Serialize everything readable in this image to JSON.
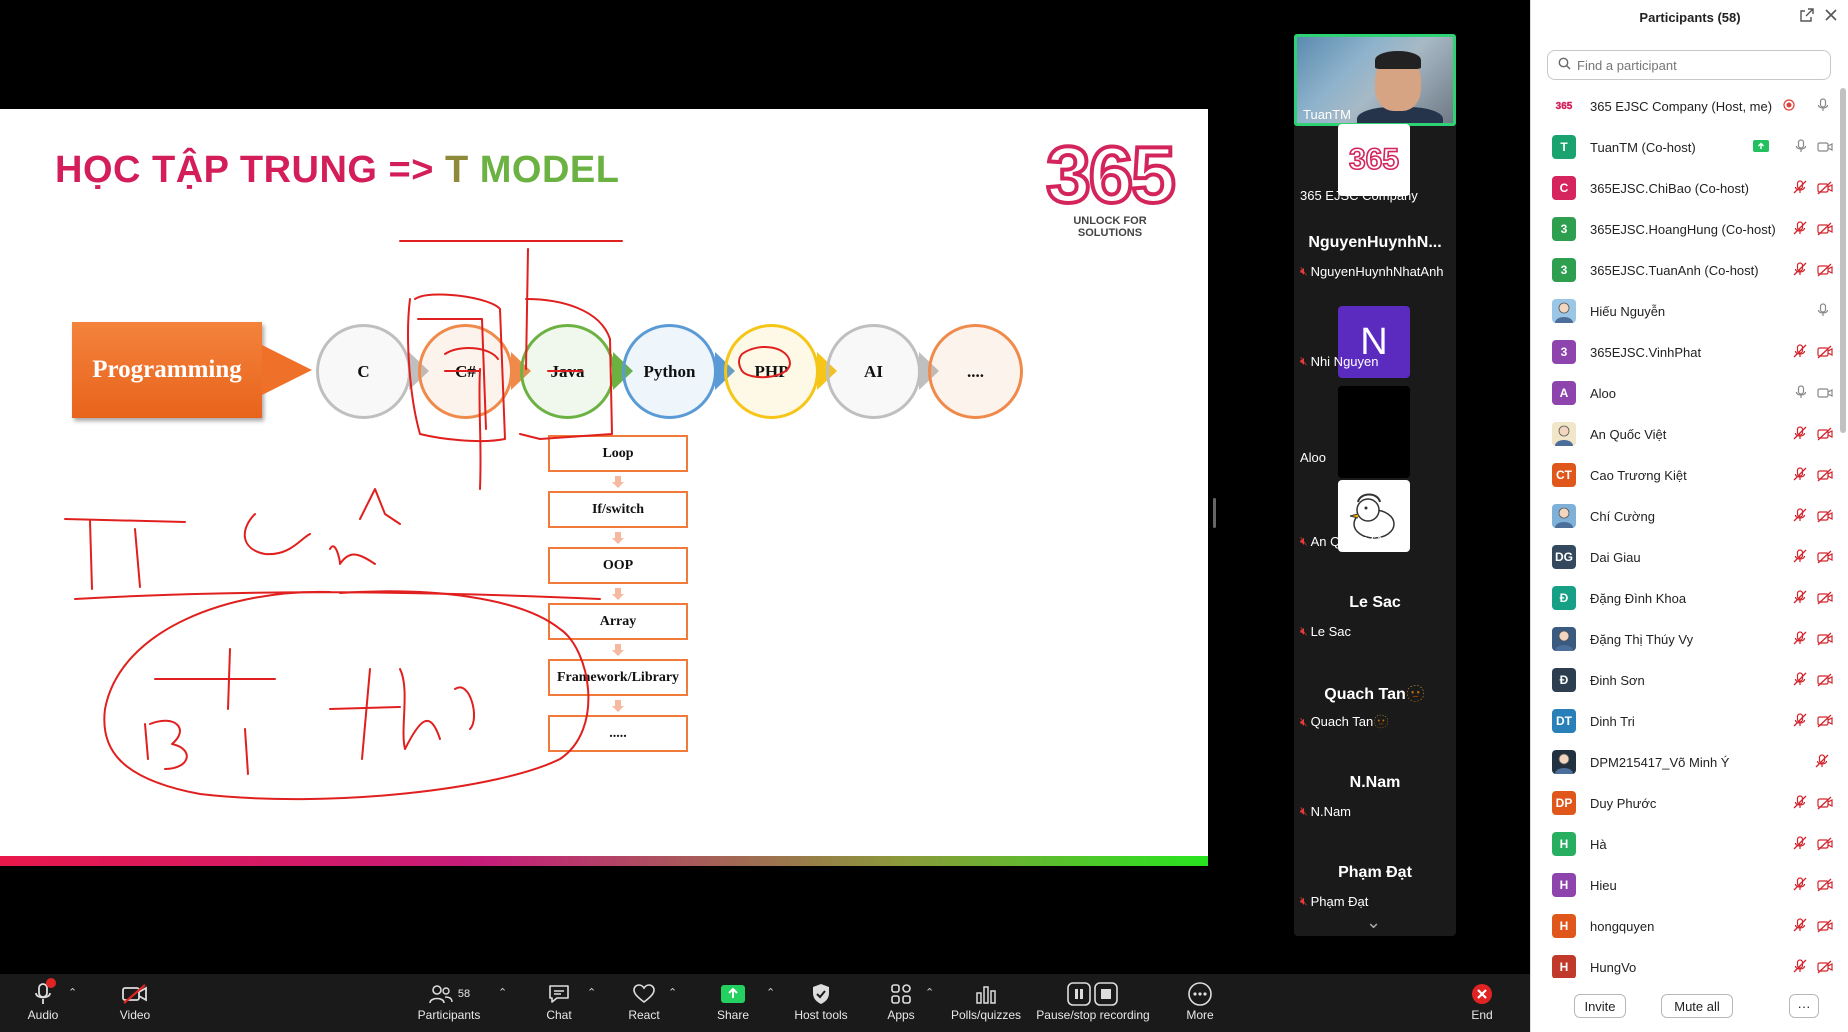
{
  "slide": {
    "title_part1": "HỌC TẬP TRUNG => ",
    "title_part2": "T ",
    "title_part3": "MODEL",
    "logo_number": "365",
    "logo_tagline": "UNLOCK FOR SOLUTIONS",
    "root_box": "Programming",
    "languages": [
      {
        "label": "C",
        "color": "#bfbfbf"
      },
      {
        "label": "C#",
        "color": "#f08a4b"
      },
      {
        "label": "Java",
        "color": "#6bb243"
      },
      {
        "label": "Python",
        "color": "#5b9bd5"
      },
      {
        "label": "PHP",
        "color": "#f5c518"
      },
      {
        "label": "AI",
        "color": "#bfbfbf"
      },
      {
        "label": "....",
        "color": "#f08a4b"
      }
    ],
    "steps": [
      "Loop",
      "If/switch",
      "OOP",
      "Array",
      "Framework/Library",
      "....."
    ]
  },
  "video_strip": {
    "active_speaker": "TuanTM",
    "company_tile": "365 EJSC Company",
    "company_logo": "365",
    "tiles": [
      {
        "big": "NguyenHuynhN...",
        "name": "NguyenHuynhNhatAnh",
        "muted": true
      },
      {
        "avatar": "N",
        "name": "Nhi Nguyen",
        "muted": true
      },
      {
        "name": "Aloo",
        "muted": false
      },
      {
        "name": "An Quốc Việt",
        "muted": true
      },
      {
        "big": "Le Sac",
        "name": "Le Sac",
        "muted": true
      },
      {
        "big": "Quach Tan🫥",
        "name": "Quach Tan🫥",
        "muted": true
      },
      {
        "big": "N.Nam",
        "name": "N.Nam",
        "muted": true
      },
      {
        "big": "Phạm Đạt",
        "name": "Phạm Đạt",
        "muted": true
      }
    ]
  },
  "toolbar": {
    "audio": "Audio",
    "video": "Video",
    "participants": "Participants",
    "participants_count": "58",
    "chat": "Chat",
    "react": "React",
    "share": "Share",
    "host_tools": "Host tools",
    "apps": "Apps",
    "polls": "Polls/quizzes",
    "recording": "Pause/stop recording",
    "more": "More",
    "end": "End"
  },
  "panel": {
    "title": "Participants (58)",
    "search_placeholder": "Find a participant",
    "participants": [
      {
        "initials": "365",
        "name": "365 EJSC Company (Host, me)",
        "color": "#ffffff",
        "mic": "on",
        "cam": "none",
        "rec": true
      },
      {
        "initials": "T",
        "name": "TuanTM (Co-host)",
        "color": "#1aa36f",
        "mic": "on",
        "cam": "on",
        "share": true
      },
      {
        "initials": "C",
        "name": "365EJSC.ChiBao (Co-host)",
        "color": "#d6245f",
        "mic": "off",
        "cam": "off"
      },
      {
        "initials": "3",
        "name": "365EJSC.HoangHung (Co-host)",
        "color": "#2e9e4f",
        "mic": "off",
        "cam": "off"
      },
      {
        "initials": "3",
        "name": "365EJSC.TuanAnh (Co-host)",
        "color": "#2e9e4f",
        "mic": "off",
        "cam": "off"
      },
      {
        "initials": "",
        "name": "Hiếu Nguyễn",
        "color": "#9cc6e6",
        "mic": "on",
        "cam": "none"
      },
      {
        "initials": "3",
        "name": "365EJSC.VinhPhat",
        "color": "#8e44ad",
        "mic": "off",
        "cam": "off"
      },
      {
        "initials": "A",
        "name": "Aloo",
        "color": "#8e44ad",
        "mic": "on",
        "cam": "on"
      },
      {
        "initials": "",
        "name": "An Quốc Việt",
        "color": "#f2e6c9",
        "mic": "off",
        "cam": "off"
      },
      {
        "initials": "CT",
        "name": "Cao Trương Kiệt",
        "color": "#e0571c",
        "mic": "off",
        "cam": "off"
      },
      {
        "initials": "",
        "name": "Chí Cường",
        "color": "#7fb0d8",
        "mic": "off",
        "cam": "off"
      },
      {
        "initials": "DG",
        "name": "Dai Giau",
        "color": "#34495e",
        "mic": "off",
        "cam": "off"
      },
      {
        "initials": "Đ",
        "name": "Đặng Đình Khoa",
        "color": "#16a085",
        "mic": "off",
        "cam": "off"
      },
      {
        "initials": "",
        "name": "Đặng Thị Thúy Vy",
        "color": "#3a5a80",
        "mic": "off",
        "cam": "off"
      },
      {
        "initials": "Đ",
        "name": "Đinh Sơn",
        "color": "#2c3e50",
        "mic": "off",
        "cam": "off"
      },
      {
        "initials": "DT",
        "name": "Dinh Tri",
        "color": "#2980b9",
        "mic": "off",
        "cam": "off"
      },
      {
        "initials": "",
        "name": "DPM215417_Võ Minh Ý",
        "color": "#22313f",
        "mic": "off",
        "cam": "none"
      },
      {
        "initials": "DP",
        "name": "Duy Phước",
        "color": "#e0571c",
        "mic": "off",
        "cam": "off"
      },
      {
        "initials": "H",
        "name": "Hà",
        "color": "#27ae60",
        "mic": "off",
        "cam": "off"
      },
      {
        "initials": "H",
        "name": "Hieu",
        "color": "#8e44ad",
        "mic": "off",
        "cam": "off"
      },
      {
        "initials": "H",
        "name": "hongquyen",
        "color": "#e0571c",
        "mic": "off",
        "cam": "off"
      },
      {
        "initials": "H",
        "name": "HungVo",
        "color": "#c0392b",
        "mic": "off",
        "cam": "off"
      }
    ],
    "invite": "Invite",
    "mute_all": "Mute all",
    "more": "···"
  }
}
